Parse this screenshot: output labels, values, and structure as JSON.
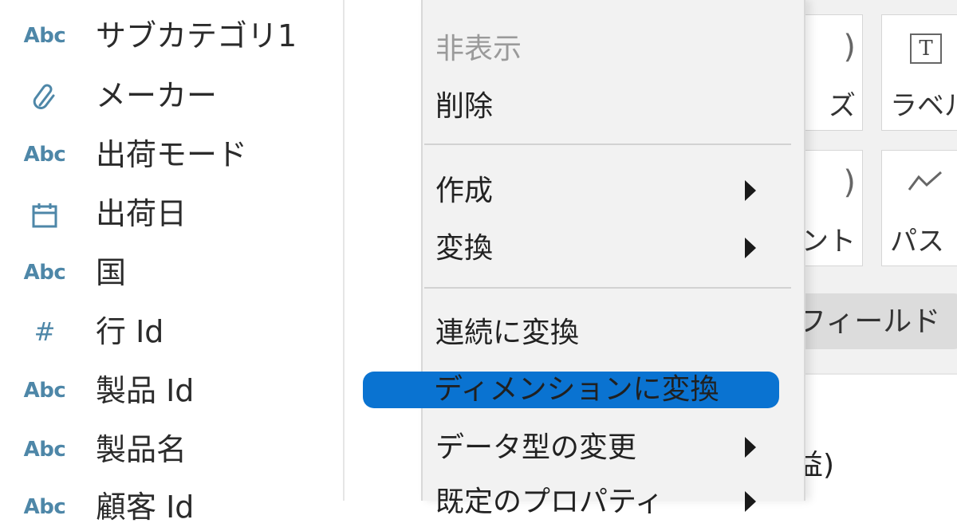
{
  "fields": [
    {
      "type_icon": "Abc",
      "icon_name": "string-type-icon",
      "label": "サブカテゴリ1"
    },
    {
      "type_icon": "📎",
      "icon_name": "paperclip-group-icon",
      "label": "メーカー"
    },
    {
      "type_icon": "Abc",
      "icon_name": "string-type-icon",
      "label": "出荷モード"
    },
    {
      "type_icon": "📅",
      "icon_name": "calendar-date-type-icon",
      "label": "出荷日"
    },
    {
      "type_icon": "Abc",
      "icon_name": "string-type-icon",
      "label": "国"
    },
    {
      "type_icon": "#",
      "icon_name": "number-type-icon",
      "label": "行 Id"
    },
    {
      "type_icon": "Abc",
      "icon_name": "string-type-icon",
      "label": "製品 Id"
    },
    {
      "type_icon": "Abc",
      "icon_name": "string-type-icon",
      "label": "製品名"
    },
    {
      "type_icon": "Abc",
      "icon_name": "string-type-icon",
      "label": "顧客 Id"
    }
  ],
  "context_menu": {
    "items": [
      {
        "label": "非表示",
        "disabled": true
      },
      {
        "label": "削除"
      },
      {
        "label": "作成",
        "submenu": true
      },
      {
        "label": "変換",
        "submenu": true
      },
      {
        "label": "連続に変換"
      },
      {
        "label": "ディメンションに変換",
        "highlighted": true
      },
      {
        "label": "データ型の変更",
        "submenu": true
      },
      {
        "label": "既定のプロパティ",
        "submenu": true
      }
    ]
  },
  "marks_card": {
    "buttons": [
      {
        "label": "ズ",
        "icon": "size-icon"
      },
      {
        "label": "ラベル",
        "icon": "T",
        "icon_name": "text-label-icon"
      },
      {
        "label": "ヒント",
        "icon": "tooltip-icon"
      },
      {
        "label": "パス",
        "icon": "〜",
        "icon_name": "path-icon"
      }
    ],
    "fields_pill": "フィールド",
    "measure_label": "益)"
  },
  "colors": {
    "highlight": "#0a73d1",
    "type_icon": "#4e87a8",
    "menu_bg": "#f2f2f2"
  }
}
